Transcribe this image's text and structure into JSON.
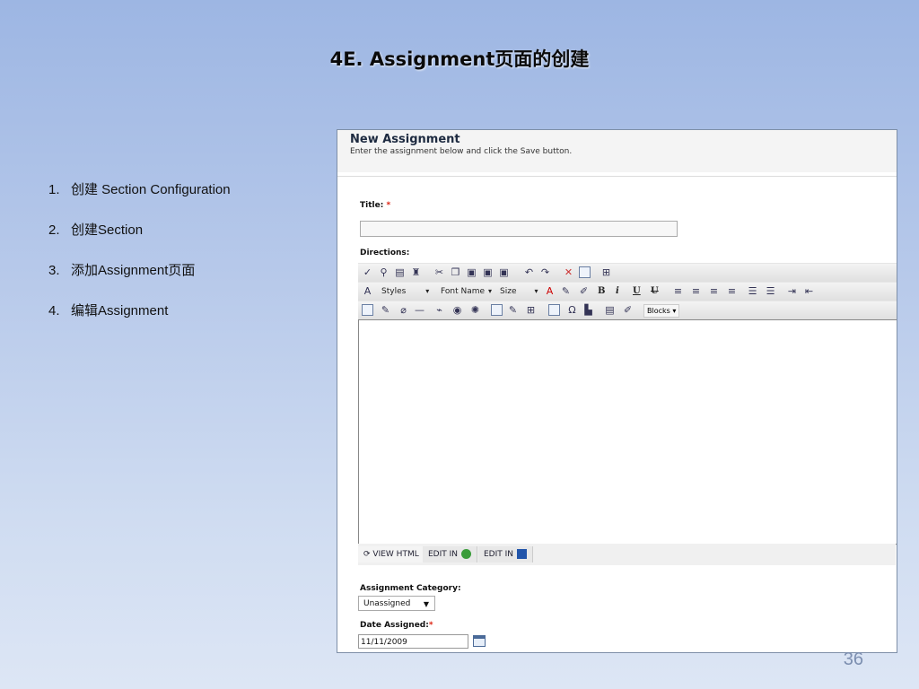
{
  "slide": {
    "title": "4E. Assignment页面的创建",
    "page_number": "36",
    "steps": [
      {
        "num": "1.",
        "text": "创建 Section Configuration"
      },
      {
        "num": "2.",
        "text": "创建Section"
      },
      {
        "num": "3.",
        "text": "添加Assignment页面"
      },
      {
        "num": "4.",
        "text": "编辑Assignment"
      }
    ]
  },
  "form": {
    "heading": "New Assignment",
    "subheading": "Enter the assignment below and click the Save button.",
    "title_label": "Title:",
    "required_mark": "*",
    "directions_label": "Directions:",
    "title_value": "",
    "toolbar": {
      "styles": "Styles",
      "font_name": "Font Name",
      "size": "Size",
      "blocks": "Blocks"
    },
    "modes": {
      "view_html": "VIEW HTML",
      "edit_in_1": "EDIT IN",
      "edit_in_2": "EDIT IN"
    },
    "category_label": "Assignment Category:",
    "category_value": "Unassigned",
    "date_label": "Date Assigned:",
    "date_value": "11/11/2009"
  }
}
